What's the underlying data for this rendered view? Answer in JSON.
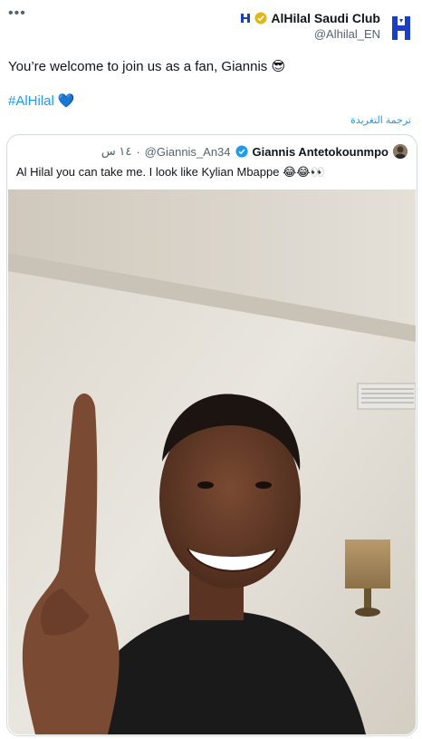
{
  "tweet": {
    "author_name": "AlHilal Saudi Club",
    "author_handle": "@Alhilal_EN",
    "text": "You’re welcome to join us as a fan, Giannis 😎",
    "hashtag": "#AlHilal",
    "hashtag_emoji": "💙",
    "translate_label": "ترجمة التغريدة",
    "more_icon": "more-dots-icon"
  },
  "quote": {
    "author_name": "Giannis Antetokounmpo",
    "author_handle": "@Giannis_An34",
    "separator": "·",
    "time": "١٤ س",
    "text": "Al Hilal you can take me. I look like Kylian Mbappe 😂😂👀"
  },
  "colors": {
    "accent": "#1d9bf0",
    "secondary_text": "#536471",
    "border": "#cfd9de",
    "club_blue": "#1b3fbf",
    "verified_gold": "#e2b719",
    "verified_blue": "#1d9bf0"
  }
}
